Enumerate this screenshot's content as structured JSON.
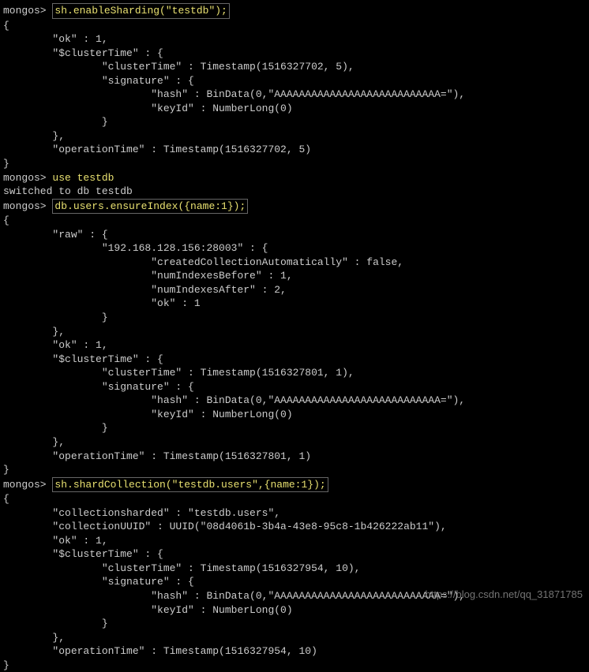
{
  "prompt": "mongos> ",
  "cmds": {
    "c1": "sh.enableSharding(\"testdb\");",
    "c2": "use testdb",
    "c2resp": "switched to db testdb",
    "c3": "db.users.ensureIndex({name:1});",
    "c4": "sh.shardCollection(\"testdb.users\",{name:1});"
  },
  "block1": {
    "l0": "{",
    "l1": "        \"ok\" : 1,",
    "l2": "        \"$clusterTime\" : {",
    "l3": "                \"clusterTime\" : Timestamp(1516327702, 5),",
    "l4": "                \"signature\" : {",
    "l5": "                        \"hash\" : BinData(0,\"AAAAAAAAAAAAAAAAAAAAAAAAAAA=\"),",
    "l6": "                        \"keyId\" : NumberLong(0)",
    "l7": "                }",
    "l8": "        },",
    "l9": "        \"operationTime\" : Timestamp(1516327702, 5)",
    "l10": "}"
  },
  "block2": {
    "l0": "{",
    "l1": "        \"raw\" : {",
    "l2": "                \"192.168.128.156:28003\" : {",
    "l3": "                        \"createdCollectionAutomatically\" : false,",
    "l4": "                        \"numIndexesBefore\" : 1,",
    "l5": "                        \"numIndexesAfter\" : 2,",
    "l6": "                        \"ok\" : 1",
    "l7": "                }",
    "l8": "        },",
    "l9": "        \"ok\" : 1,",
    "l10": "        \"$clusterTime\" : {",
    "l11": "                \"clusterTime\" : Timestamp(1516327801, 1),",
    "l12": "                \"signature\" : {",
    "l13": "                        \"hash\" : BinData(0,\"AAAAAAAAAAAAAAAAAAAAAAAAAAA=\"),",
    "l14": "                        \"keyId\" : NumberLong(0)",
    "l15": "                }",
    "l16": "        },",
    "l17": "        \"operationTime\" : Timestamp(1516327801, 1)",
    "l18": "}"
  },
  "block3": {
    "l0": "{",
    "l1": "        \"collectionsharded\" : \"testdb.users\",",
    "l2": "        \"collectionUUID\" : UUID(\"08d4061b-3b4a-43e8-95c8-1b426222ab11\"),",
    "l3": "        \"ok\" : 1,",
    "l4": "        \"$clusterTime\" : {",
    "l5": "                \"clusterTime\" : Timestamp(1516327954, 10),",
    "l6": "                \"signature\" : {",
    "l7": "                        \"hash\" : BinData(0,\"AAAAAAAAAAAAAAAAAAAAAAAAAAA=\"),",
    "l8": "                        \"keyId\" : NumberLong(0)",
    "l9": "                }",
    "l10": "        },",
    "l11": "        \"operationTime\" : Timestamp(1516327954, 10)",
    "l12": "}"
  },
  "watermark": "https://blog.csdn.net/qq_31871785"
}
